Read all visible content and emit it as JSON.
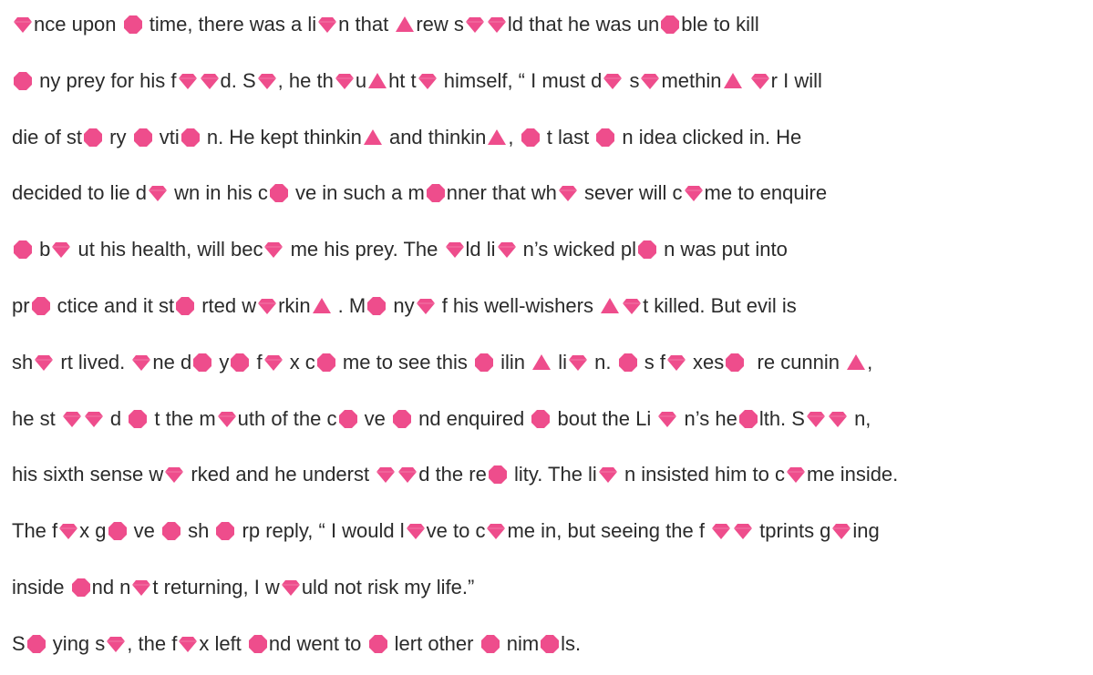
{
  "colors": {
    "text": "#2b2b2b",
    "shape": "#ee4d8c"
  },
  "legend": {
    "gem": "o",
    "octagon": "a",
    "triangle": "g"
  },
  "lines": [
    [
      {
        "s": "gem"
      },
      {
        "t": "nce upon "
      },
      {
        "s": "octagon"
      },
      {
        "t": " time, there was a li"
      },
      {
        "s": "gem"
      },
      {
        "t": "n that "
      },
      {
        "s": "triangle"
      },
      {
        "t": "rew s"
      },
      {
        "s": "gem"
      },
      {
        "s": "gem"
      },
      {
        "t": "ld that he was un"
      },
      {
        "s": "octagon"
      },
      {
        "t": "ble to kill"
      }
    ],
    [
      {
        "s": "octagon"
      },
      {
        "t": " ny prey for his f"
      },
      {
        "s": "gem"
      },
      {
        "s": "gem"
      },
      {
        "t": "d. S"
      },
      {
        "s": "gem"
      },
      {
        "t": ", he th"
      },
      {
        "s": "gem"
      },
      {
        "t": "u"
      },
      {
        "s": "triangle"
      },
      {
        "t": "ht t"
      },
      {
        "s": "gem"
      },
      {
        "t": " himself, “ I must d"
      },
      {
        "s": "gem"
      },
      {
        "t": " s"
      },
      {
        "s": "gem"
      },
      {
        "t": "methin"
      },
      {
        "s": "triangle"
      },
      {
        "t": " "
      },
      {
        "s": "gem"
      },
      {
        "t": "r I will"
      }
    ],
    [
      {
        "t": "die of st"
      },
      {
        "s": "octagon"
      },
      {
        "t": " ry "
      },
      {
        "s": "octagon"
      },
      {
        "t": " vti"
      },
      {
        "s": "octagon"
      },
      {
        "t": " n. He kept thinkin"
      },
      {
        "s": "triangle"
      },
      {
        "t": " and thinkin"
      },
      {
        "s": "triangle"
      },
      {
        "t": ", "
      },
      {
        "s": "octagon"
      },
      {
        "t": " t last "
      },
      {
        "s": "octagon"
      },
      {
        "t": " n idea clicked in. He"
      }
    ],
    [
      {
        "t": "decided to lie d"
      },
      {
        "s": "gem"
      },
      {
        "t": " wn in his c"
      },
      {
        "s": "octagon"
      },
      {
        "t": " ve in such a m"
      },
      {
        "s": "octagon"
      },
      {
        "t": "nner that wh"
      },
      {
        "s": "gem"
      },
      {
        "t": " sever will c"
      },
      {
        "s": "gem"
      },
      {
        "t": "me to enquire"
      }
    ],
    [
      {
        "s": "octagon"
      },
      {
        "t": " b"
      },
      {
        "s": "gem"
      },
      {
        "t": " ut his health, will bec"
      },
      {
        "s": "gem"
      },
      {
        "t": " me his prey. The "
      },
      {
        "s": "gem"
      },
      {
        "t": "ld li"
      },
      {
        "s": "gem"
      },
      {
        "t": " n’s wicked pl"
      },
      {
        "s": "octagon"
      },
      {
        "t": " n was put into"
      }
    ],
    [
      {
        "t": "pr"
      },
      {
        "s": "octagon"
      },
      {
        "t": " ctice and it st"
      },
      {
        "s": "octagon"
      },
      {
        "t": " rted w"
      },
      {
        "s": "gem"
      },
      {
        "t": "rkin"
      },
      {
        "s": "triangle"
      },
      {
        "t": " . M"
      },
      {
        "s": "octagon"
      },
      {
        "t": " ny"
      },
      {
        "s": "gem"
      },
      {
        "t": " f his well-wishers "
      },
      {
        "s": "triangle"
      },
      {
        "s": "gem"
      },
      {
        "t": "t killed. But evil is"
      }
    ],
    [
      {
        "t": "sh"
      },
      {
        "s": "gem"
      },
      {
        "t": " rt lived. "
      },
      {
        "s": "gem"
      },
      {
        "t": "ne d"
      },
      {
        "s": "octagon"
      },
      {
        "t": " y"
      },
      {
        "s": "octagon"
      },
      {
        "t": " f"
      },
      {
        "s": "gem"
      },
      {
        "t": " x c"
      },
      {
        "s": "octagon"
      },
      {
        "t": " me to see this "
      },
      {
        "s": "octagon"
      },
      {
        "t": " ilin "
      },
      {
        "s": "triangle"
      },
      {
        "t": " li"
      },
      {
        "s": "gem"
      },
      {
        "t": " n. "
      },
      {
        "s": "octagon"
      },
      {
        "t": " s f"
      },
      {
        "s": "gem"
      },
      {
        "t": " xes"
      },
      {
        "s": "octagon"
      },
      {
        "t": "  re cunnin "
      },
      {
        "s": "triangle"
      },
      {
        "t": ","
      }
    ],
    [
      {
        "t": "he st "
      },
      {
        "s": "gem"
      },
      {
        "s": "gem"
      },
      {
        "t": " d "
      },
      {
        "s": "octagon"
      },
      {
        "t": " t the m"
      },
      {
        "s": "gem"
      },
      {
        "t": "uth of the c"
      },
      {
        "s": "octagon"
      },
      {
        "t": " ve "
      },
      {
        "s": "octagon"
      },
      {
        "t": " nd enquired "
      },
      {
        "s": "octagon"
      },
      {
        "t": " bout the Li "
      },
      {
        "s": "gem"
      },
      {
        "t": " n’s he"
      },
      {
        "s": "octagon"
      },
      {
        "t": "lth. S"
      },
      {
        "s": "gem"
      },
      {
        "s": "gem"
      },
      {
        "t": " n,"
      }
    ],
    [
      {
        "t": "his sixth sense w"
      },
      {
        "s": "gem"
      },
      {
        "t": " rked and he underst "
      },
      {
        "s": "gem"
      },
      {
        "s": "gem"
      },
      {
        "t": "d the re"
      },
      {
        "s": "octagon"
      },
      {
        "t": " lity. The li"
      },
      {
        "s": "gem"
      },
      {
        "t": " n insisted him to c"
      },
      {
        "s": "gem"
      },
      {
        "t": "me inside."
      }
    ],
    [
      {
        "t": "The f"
      },
      {
        "s": "gem"
      },
      {
        "t": "x g"
      },
      {
        "s": "octagon"
      },
      {
        "t": " ve "
      },
      {
        "s": "octagon"
      },
      {
        "t": " sh "
      },
      {
        "s": "octagon"
      },
      {
        "t": " rp reply, “ I would l"
      },
      {
        "s": "gem"
      },
      {
        "t": "ve to c"
      },
      {
        "s": "gem"
      },
      {
        "t": "me in, but seeing the f "
      },
      {
        "s": "gem"
      },
      {
        "s": "gem"
      },
      {
        "t": " tprints g"
      },
      {
        "s": "gem"
      },
      {
        "t": "ing"
      }
    ],
    [
      {
        "t": "inside "
      },
      {
        "s": "octagon"
      },
      {
        "t": "nd n"
      },
      {
        "s": "gem"
      },
      {
        "t": "t returning, I w"
      },
      {
        "s": "gem"
      },
      {
        "t": "uld not risk my life.”"
      }
    ],
    [
      {
        "t": "S"
      },
      {
        "s": "octagon"
      },
      {
        "t": " ying s"
      },
      {
        "s": "gem"
      },
      {
        "t": ", the f"
      },
      {
        "s": "gem"
      },
      {
        "t": "x left "
      },
      {
        "s": "octagon"
      },
      {
        "t": "nd went to "
      },
      {
        "s": "octagon"
      },
      {
        "t": " lert other "
      },
      {
        "s": "octagon"
      },
      {
        "t": " nim"
      },
      {
        "s": "octagon"
      },
      {
        "t": "ls."
      }
    ]
  ]
}
